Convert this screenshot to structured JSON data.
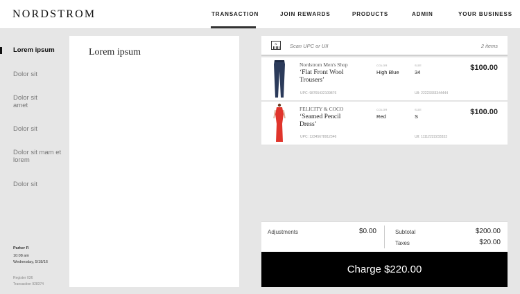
{
  "header": {
    "logo": "NORDSTROM",
    "nav": [
      "TRANSACTION",
      "JOIN REWARDS",
      "PRODUCTS",
      "ADMIN",
      "YOUR BUSINESS"
    ],
    "active_nav": "TRANSACTION"
  },
  "sidebar": {
    "items": [
      {
        "label": "Lorem ipsum",
        "active": true
      },
      {
        "label": "Dolor sit"
      },
      {
        "label": "Dolor sit amet"
      },
      {
        "label": "Dolor sit"
      },
      {
        "label": "Dolor sit mam et lorem"
      },
      {
        "label": "Dolor sit"
      }
    ],
    "user": {
      "name": "Parker P.",
      "time": "10:08 am",
      "date": "Wednesday, 5/18/16",
      "register": "Register 036",
      "transaction": "Transaction 928374"
    }
  },
  "content": {
    "title": "Lorem ipsum"
  },
  "cart": {
    "scan_placeholder": "Scan UPC or UII",
    "scan_icon_text": "N",
    "items_count": "2 items",
    "items": [
      {
        "brand": "Nordstrom Men's Shop",
        "name": "‘Flat Front Wool Trousers’",
        "color_label": "COLOR",
        "color": "High Blue",
        "size_label": "SIZE",
        "size": "34",
        "price": "$100.00",
        "upc": "UPC: 98765432109876",
        "uii": "UII: 22223333344444"
      },
      {
        "brand": "FELICITY & COCO",
        "name": "‘Seamed Pencil Dress’",
        "color_label": "COLOR",
        "color": "Red",
        "size_label": "SIZE",
        "size": "S",
        "price": "$100.00",
        "upc": "UPC: 12345678912346",
        "uii": "UII: 11112222233333"
      }
    ]
  },
  "totals": {
    "adjustments_label": "Adjustments",
    "adjustments": "$0.00",
    "subtotal_label": "Subtotal",
    "subtotal": "$200.00",
    "taxes_label": "Taxes",
    "taxes": "$20.00",
    "charge_label": "Charge $220.00"
  },
  "colors": {
    "dress": "#e0342b",
    "trousers": "#2b3a5a",
    "charge_bg": "#000000"
  },
  "icons": [
    "barcode-scan-icon",
    "trousers-image",
    "dress-image"
  ]
}
